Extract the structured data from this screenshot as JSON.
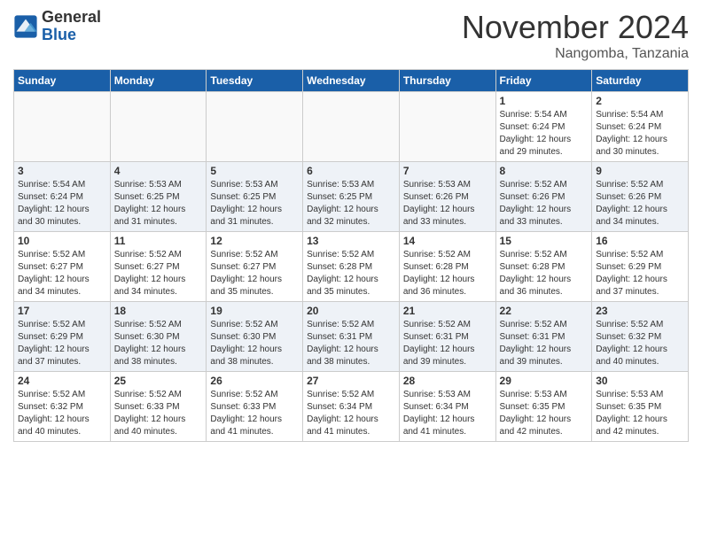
{
  "header": {
    "logo_general": "General",
    "logo_blue": "Blue",
    "month_title": "November 2024",
    "location": "Nangomba, Tanzania"
  },
  "days_of_week": [
    "Sunday",
    "Monday",
    "Tuesday",
    "Wednesday",
    "Thursday",
    "Friday",
    "Saturday"
  ],
  "weeks": [
    {
      "row": 1,
      "cells": [
        {
          "day": "",
          "info": ""
        },
        {
          "day": "",
          "info": ""
        },
        {
          "day": "",
          "info": ""
        },
        {
          "day": "",
          "info": ""
        },
        {
          "day": "",
          "info": ""
        },
        {
          "day": "1",
          "info": "Sunrise: 5:54 AM\nSunset: 6:24 PM\nDaylight: 12 hours and 29 minutes."
        },
        {
          "day": "2",
          "info": "Sunrise: 5:54 AM\nSunset: 6:24 PM\nDaylight: 12 hours and 30 minutes."
        }
      ]
    },
    {
      "row": 2,
      "cells": [
        {
          "day": "3",
          "info": "Sunrise: 5:54 AM\nSunset: 6:24 PM\nDaylight: 12 hours and 30 minutes."
        },
        {
          "day": "4",
          "info": "Sunrise: 5:53 AM\nSunset: 6:25 PM\nDaylight: 12 hours and 31 minutes."
        },
        {
          "day": "5",
          "info": "Sunrise: 5:53 AM\nSunset: 6:25 PM\nDaylight: 12 hours and 31 minutes."
        },
        {
          "day": "6",
          "info": "Sunrise: 5:53 AM\nSunset: 6:25 PM\nDaylight: 12 hours and 32 minutes."
        },
        {
          "day": "7",
          "info": "Sunrise: 5:53 AM\nSunset: 6:26 PM\nDaylight: 12 hours and 33 minutes."
        },
        {
          "day": "8",
          "info": "Sunrise: 5:52 AM\nSunset: 6:26 PM\nDaylight: 12 hours and 33 minutes."
        },
        {
          "day": "9",
          "info": "Sunrise: 5:52 AM\nSunset: 6:26 PM\nDaylight: 12 hours and 34 minutes."
        }
      ]
    },
    {
      "row": 3,
      "cells": [
        {
          "day": "10",
          "info": "Sunrise: 5:52 AM\nSunset: 6:27 PM\nDaylight: 12 hours and 34 minutes."
        },
        {
          "day": "11",
          "info": "Sunrise: 5:52 AM\nSunset: 6:27 PM\nDaylight: 12 hours and 34 minutes."
        },
        {
          "day": "12",
          "info": "Sunrise: 5:52 AM\nSunset: 6:27 PM\nDaylight: 12 hours and 35 minutes."
        },
        {
          "day": "13",
          "info": "Sunrise: 5:52 AM\nSunset: 6:28 PM\nDaylight: 12 hours and 35 minutes."
        },
        {
          "day": "14",
          "info": "Sunrise: 5:52 AM\nSunset: 6:28 PM\nDaylight: 12 hours and 36 minutes."
        },
        {
          "day": "15",
          "info": "Sunrise: 5:52 AM\nSunset: 6:28 PM\nDaylight: 12 hours and 36 minutes."
        },
        {
          "day": "16",
          "info": "Sunrise: 5:52 AM\nSunset: 6:29 PM\nDaylight: 12 hours and 37 minutes."
        }
      ]
    },
    {
      "row": 4,
      "cells": [
        {
          "day": "17",
          "info": "Sunrise: 5:52 AM\nSunset: 6:29 PM\nDaylight: 12 hours and 37 minutes."
        },
        {
          "day": "18",
          "info": "Sunrise: 5:52 AM\nSunset: 6:30 PM\nDaylight: 12 hours and 38 minutes."
        },
        {
          "day": "19",
          "info": "Sunrise: 5:52 AM\nSunset: 6:30 PM\nDaylight: 12 hours and 38 minutes."
        },
        {
          "day": "20",
          "info": "Sunrise: 5:52 AM\nSunset: 6:31 PM\nDaylight: 12 hours and 38 minutes."
        },
        {
          "day": "21",
          "info": "Sunrise: 5:52 AM\nSunset: 6:31 PM\nDaylight: 12 hours and 39 minutes."
        },
        {
          "day": "22",
          "info": "Sunrise: 5:52 AM\nSunset: 6:31 PM\nDaylight: 12 hours and 39 minutes."
        },
        {
          "day": "23",
          "info": "Sunrise: 5:52 AM\nSunset: 6:32 PM\nDaylight: 12 hours and 40 minutes."
        }
      ]
    },
    {
      "row": 5,
      "cells": [
        {
          "day": "24",
          "info": "Sunrise: 5:52 AM\nSunset: 6:32 PM\nDaylight: 12 hours and 40 minutes."
        },
        {
          "day": "25",
          "info": "Sunrise: 5:52 AM\nSunset: 6:33 PM\nDaylight: 12 hours and 40 minutes."
        },
        {
          "day": "26",
          "info": "Sunrise: 5:52 AM\nSunset: 6:33 PM\nDaylight: 12 hours and 41 minutes."
        },
        {
          "day": "27",
          "info": "Sunrise: 5:52 AM\nSunset: 6:34 PM\nDaylight: 12 hours and 41 minutes."
        },
        {
          "day": "28",
          "info": "Sunrise: 5:53 AM\nSunset: 6:34 PM\nDaylight: 12 hours and 41 minutes."
        },
        {
          "day": "29",
          "info": "Sunrise: 5:53 AM\nSunset: 6:35 PM\nDaylight: 12 hours and 42 minutes."
        },
        {
          "day": "30",
          "info": "Sunrise: 5:53 AM\nSunset: 6:35 PM\nDaylight: 12 hours and 42 minutes."
        }
      ]
    }
  ]
}
